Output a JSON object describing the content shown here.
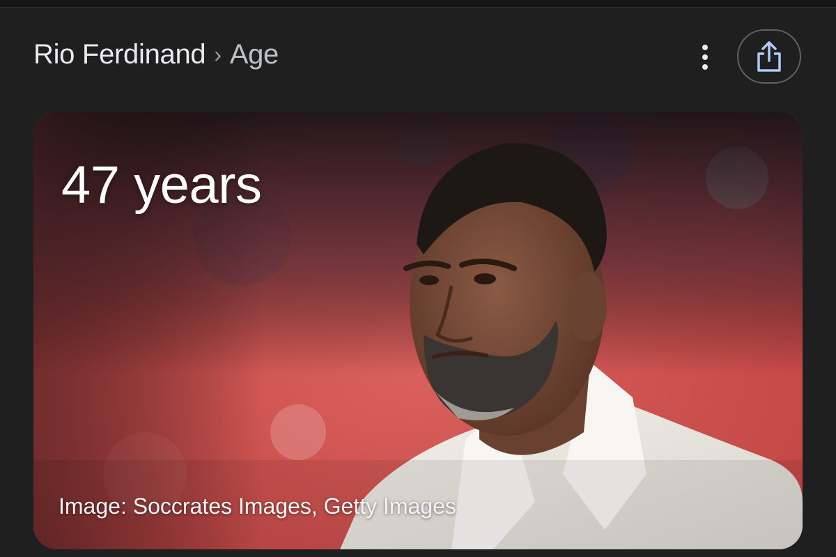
{
  "header": {
    "entity": "Rio Ferdinand",
    "separator": "›",
    "attribute": "Age",
    "more_icon": "more-vert-icon",
    "share_icon": "share-icon"
  },
  "card": {
    "age_value": "47 years",
    "image_credit": "Image: Soccrates Images, Getty Images"
  },
  "colors": {
    "background": "#1f1f1f",
    "text_primary": "#e8eaed",
    "share_icon": "#aecbfa"
  }
}
